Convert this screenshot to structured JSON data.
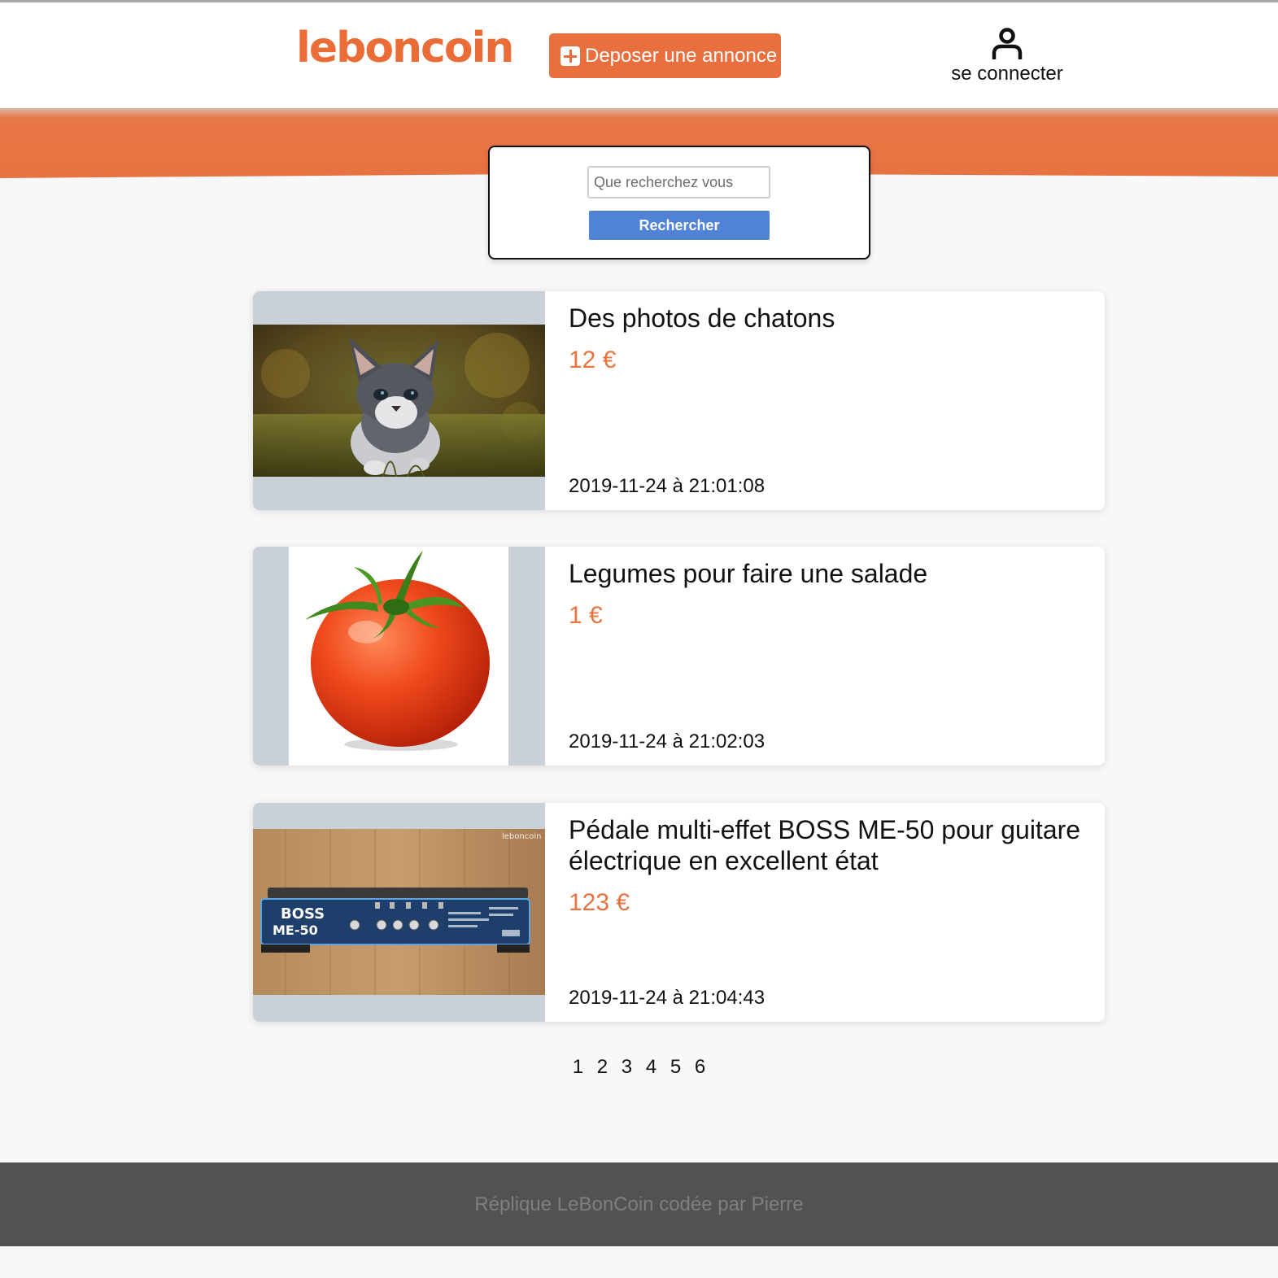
{
  "header": {
    "logo_text": "leboncoin",
    "post_button_label": "Deposer une annonce",
    "login_label": "se connecter"
  },
  "search": {
    "placeholder": "Que recherchez vous",
    "button_label": "Rechercher"
  },
  "listings": [
    {
      "title": "Des photos de chatons",
      "price": "12 €",
      "date": "2019-11-24 à 21:01:08",
      "image": "kitten-photo"
    },
    {
      "title": "Legumes pour faire une salade",
      "price": "1 €",
      "date": "2019-11-24 à 21:02:03",
      "image": "tomato-photo"
    },
    {
      "title": "Pédale multi-effet BOSS ME-50 pour guitare électrique en excellent état",
      "price": "123 €",
      "date": "2019-11-24 à 21:04:43",
      "image": "guitar-pedal-photo",
      "image_text": {
        "brand": "BOSS",
        "model": "ME-50",
        "watermark": "leboncoin"
      }
    },
    {}
  ],
  "pagination": {
    "pages": [
      "1",
      "2",
      "3",
      "4",
      "5",
      "6"
    ]
  },
  "footer": {
    "credit": "Réplique LeBonCoin codée par Pierre"
  },
  "colors": {
    "brand": "#e8733f",
    "search_button": "#5083d6",
    "footer_bg": "#525252",
    "image_bg": "#c9d0d8"
  }
}
